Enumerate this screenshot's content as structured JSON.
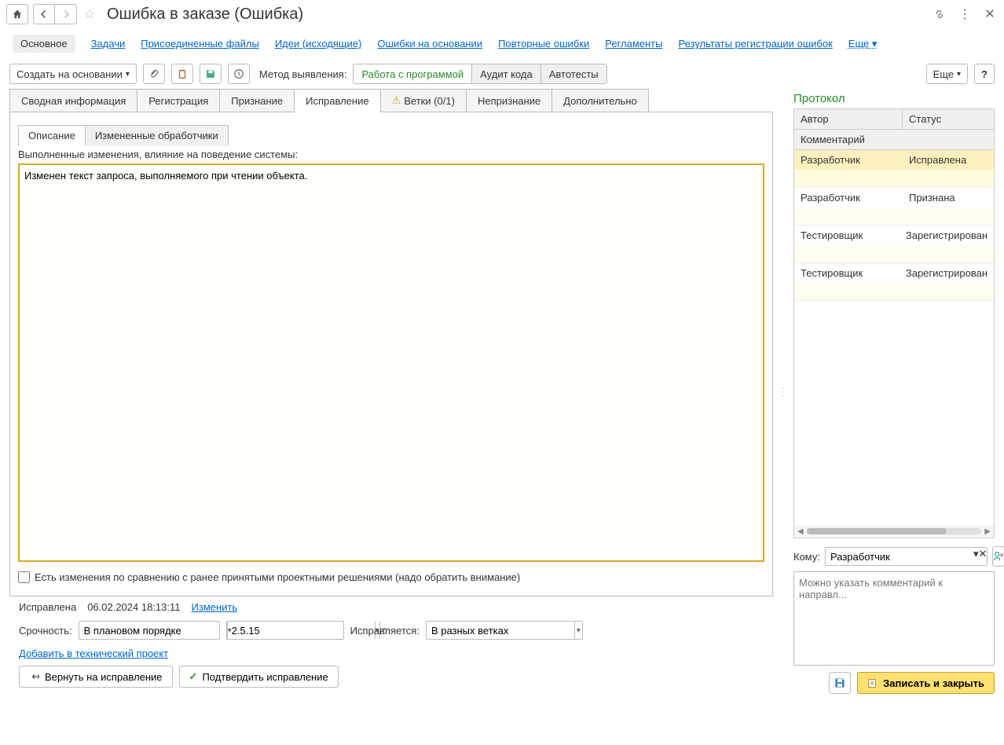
{
  "titlebar": {
    "title": "Ошибка в заказе (Ошибка)"
  },
  "linkbar": {
    "main": "Основное",
    "tasks": "Задачи",
    "files": "Присоединенные файлы",
    "ideas": "Идеи (исходящие)",
    "errors_base": "Ошибки на основании",
    "repeated": "Повторные ошибки",
    "reglaments": "Регламенты",
    "results": "Результаты регистрации ошибок",
    "more": "Еще"
  },
  "toolbar": {
    "create": "Создать на основании",
    "method_label": "Метод выявления:",
    "method_1": "Работа с программой",
    "method_2": "Аудит кода",
    "method_3": "Автотесты",
    "more": "Еще"
  },
  "tabs": {
    "summary": "Сводная информация",
    "registration": "Регистрация",
    "recognition": "Признание",
    "fix": "Исправление",
    "branches": "Ветки (0/1)",
    "nonrecognition": "Непризнание",
    "additional": "Дополнительно"
  },
  "inner_tabs": {
    "description": "Описание",
    "changed": "Измененные обработчики"
  },
  "description": {
    "label": "Выполненные изменения, влияние на поведение системы:",
    "text": "Изменен текст запроса, выполняемого при чтении объекта."
  },
  "checkbox_label": "Есть изменения по  сравнению с ранее принятыми проектными решениями (надо обратить внимание)",
  "status": {
    "state": "Исправлена",
    "datetime": "06.02.2024 18:13:11",
    "change": "Изменить"
  },
  "form": {
    "urgency_label": "Срочность:",
    "urgency_value": "В плановом порядке",
    "version_value": "2.5.15",
    "fix_label": "Исправляется:",
    "fix_value": "В разных ветках"
  },
  "link_tech": "Добавить в технический проект",
  "bottom": {
    "return": "Вернуть на исправление",
    "confirm": "Подтвердить исправление"
  },
  "protocol": {
    "title": "Протокол",
    "author_h": "Автор",
    "status_h": "Статус",
    "comment_h": "Комментарий",
    "rows": [
      {
        "author": "Разработчик",
        "status": "Исправлена"
      },
      {
        "author": "Разработчик",
        "status": "Признана"
      },
      {
        "author": "Тестировщик",
        "status": "Зарегистрирован"
      },
      {
        "author": "Тестировщик",
        "status": "Зарегистрирован"
      }
    ]
  },
  "komu": {
    "label": "Кому:",
    "value": "Разработчик",
    "comment_placeholder": "Можно указать комментарий к направл..."
  },
  "save": "Записать и закрыть"
}
